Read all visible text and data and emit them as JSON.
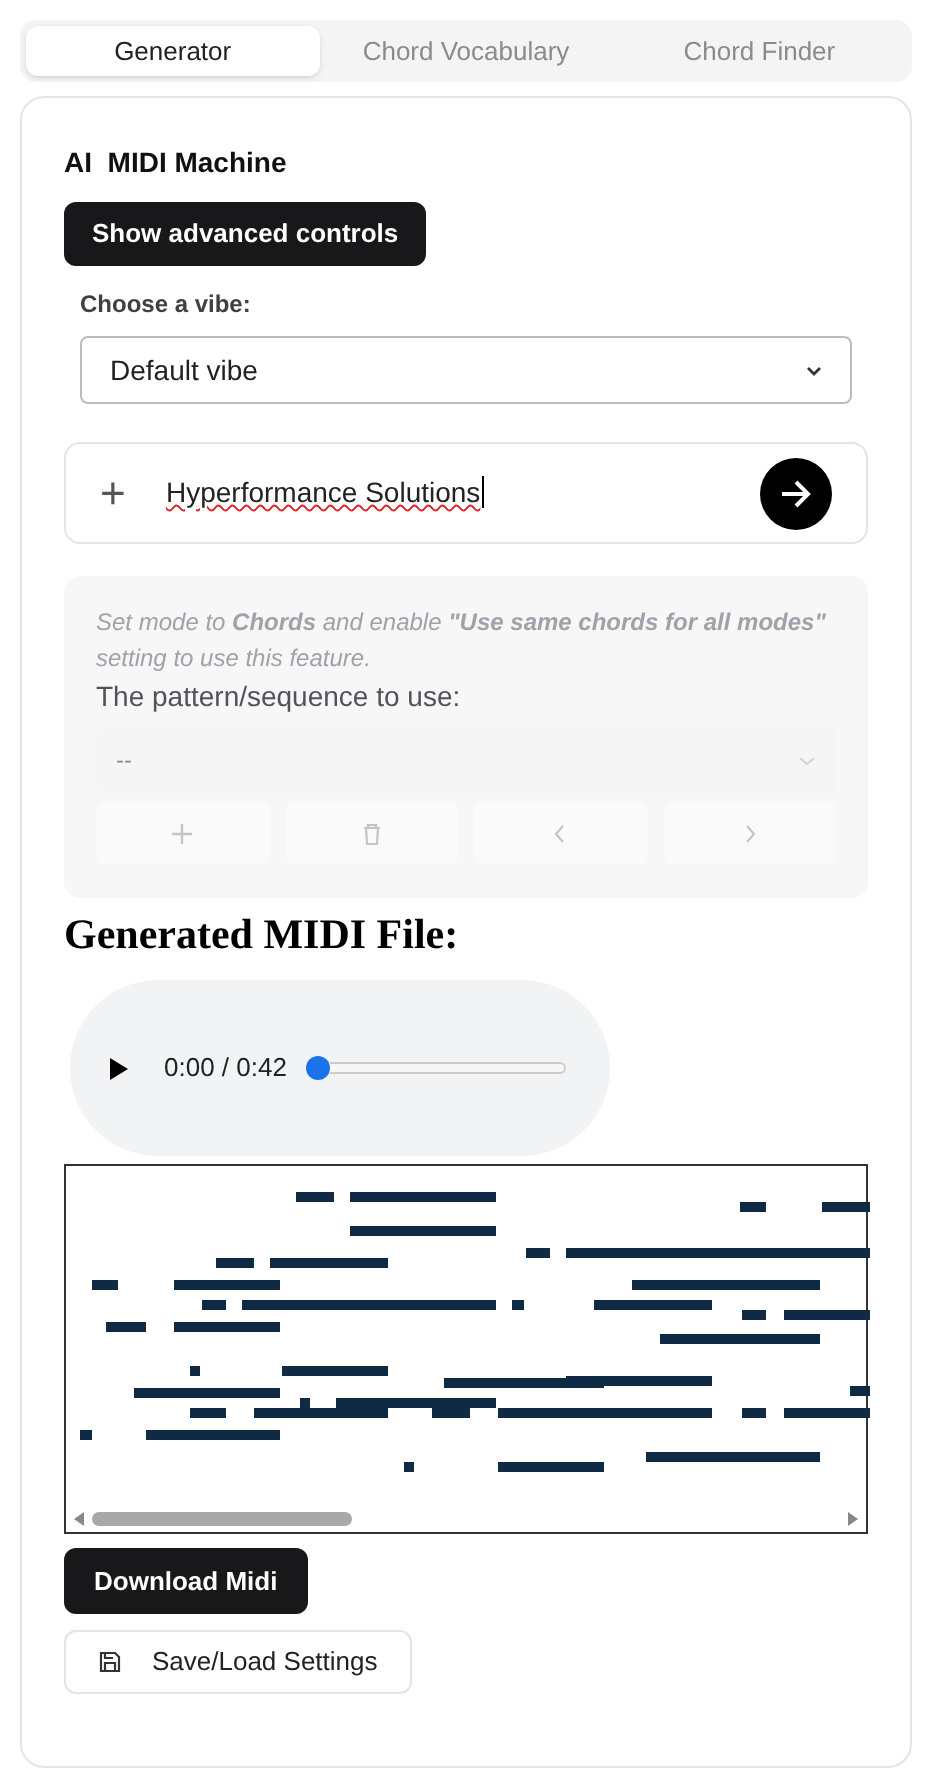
{
  "tabs": [
    {
      "label": "Generator",
      "selected": true
    },
    {
      "label": "Chord Vocabulary",
      "selected": false
    },
    {
      "label": "Chord Finder",
      "selected": false
    }
  ],
  "title": "AI  MIDI Machine",
  "advanced_button": "Show advanced controls",
  "vibe": {
    "label": "Choose a vibe:",
    "value": "Default vibe"
  },
  "prompt": {
    "value": "Hyperformance Solutions",
    "plus": "+"
  },
  "pattern_panel": {
    "disabled": true,
    "note": "Set mode to **Chords** and enable **\"Use same chords for all modes\"** setting to use this feature.",
    "label": "The pattern/sequence to use:",
    "value": "--",
    "buttons": [
      {
        "kind": "add"
      },
      {
        "kind": "delete"
      },
      {
        "kind": "prev"
      },
      {
        "kind": "next"
      }
    ]
  },
  "output": {
    "heading": "Generated MIDI File:",
    "time": "0:00 / 0:42",
    "level": 0
  },
  "download_button": "Download Midi",
  "settings_button": "Save/Load Settings"
}
